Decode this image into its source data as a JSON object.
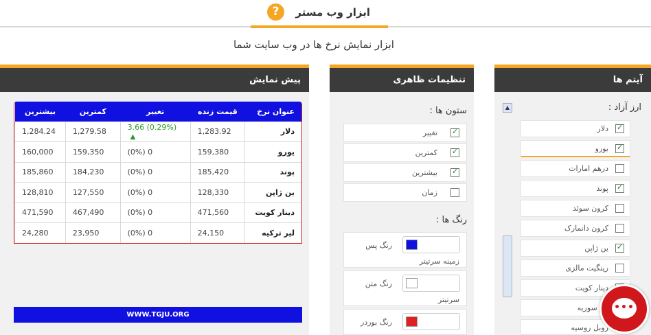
{
  "header": {
    "tab_title": "ابزار وب مستر",
    "help_label": "?",
    "subtitle": "ابزار نمایش نرخ ها در وب سایت شما"
  },
  "colors": {
    "accent": "#f5a623",
    "panel_head": "#3b3b3b",
    "table_head": "#1010e0",
    "table_border": "#d42020",
    "positive": "#2b9a2b",
    "chat": "#d0171c"
  },
  "preview": {
    "title": "پیش نمایش",
    "columns": [
      "عنوان نرخ",
      "قیمت زنده",
      "تغییر",
      "کمترین",
      "بیشترین"
    ],
    "rows": [
      {
        "name": "دلار",
        "price": "1,283.92",
        "change": "3.66 (0.29%)",
        "up": true,
        "low": "1,279.58",
        "high": "1,284.24"
      },
      {
        "name": "یورو",
        "price": "159,380",
        "change": "(0%) 0",
        "up": false,
        "low": "159,350",
        "high": "160,000"
      },
      {
        "name": "پوند",
        "price": "185,420",
        "change": "(0%) 0",
        "up": false,
        "low": "184,230",
        "high": "185,860"
      },
      {
        "name": "ین ژاپن",
        "price": "128,330",
        "change": "(0%) 0",
        "up": false,
        "low": "127,550",
        "high": "128,810"
      },
      {
        "name": "دینار کویت",
        "price": "471,560",
        "change": "(0%) 0",
        "up": false,
        "low": "467,490",
        "high": "471,590"
      },
      {
        "name": "لیر ترکیه",
        "price": "24,150",
        "change": "(0%) 0",
        "up": false,
        "low": "23,950",
        "high": "24,280"
      }
    ],
    "footer": "WWW.TGJU.ORG"
  },
  "settings": {
    "title": "تنظیمات ظاهری",
    "columns_label": "ستون ها :",
    "columns": [
      {
        "label": "تغییر",
        "checked": true
      },
      {
        "label": "کمترین",
        "checked": true
      },
      {
        "label": "بیشترین",
        "checked": true
      },
      {
        "label": "زمان",
        "checked": false
      }
    ],
    "colors_label": "رنگ ها :",
    "color_rows": [
      {
        "label": "رنگ پس",
        "label2": "زمینه سرتیتر",
        "value": "#1010e0"
      },
      {
        "label": "رنگ متن",
        "label2": "سرتیتر",
        "value": "#ffffff"
      },
      {
        "label": "رنگ بوردر",
        "label2": "",
        "value": "#e02020"
      }
    ]
  },
  "items": {
    "title": "آیتم ها",
    "group_label": "ارز آزاد :",
    "list": [
      {
        "label": "دلار",
        "checked": true
      },
      {
        "label": "یورو",
        "checked": true
      },
      {
        "label": "درهم امارات",
        "checked": false
      },
      {
        "label": "پوند",
        "checked": true
      },
      {
        "label": "کرون سوئد",
        "checked": false
      },
      {
        "label": "کرون دانمارک",
        "checked": false
      },
      {
        "label": "ین ژاپن",
        "checked": true
      },
      {
        "label": "رینگیت مالزی",
        "checked": false
      },
      {
        "label": "دینار کویت",
        "checked": true
      },
      {
        "label": "لیر سوریه",
        "checked": false
      },
      {
        "label": "روبل روسیه",
        "checked": false
      }
    ]
  },
  "chat": {
    "icon": "chat-bubble-icon",
    "dots": "•••"
  }
}
